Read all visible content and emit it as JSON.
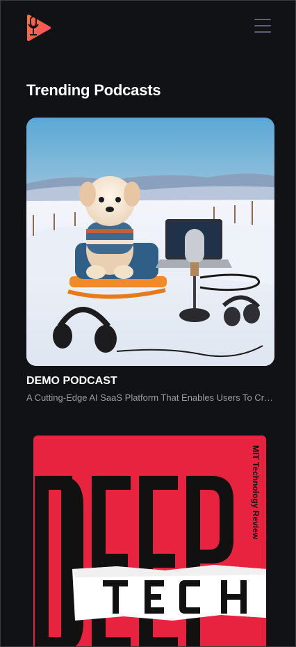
{
  "header": {
    "logo_icon": "podcast-microphone-play-logo-icon",
    "menu_icon": "hamburger-menu-icon"
  },
  "trending": {
    "title": "Trending Podcasts",
    "podcasts": [
      {
        "title": "DEMO PODCAST",
        "description": "A Cutting-Edge AI SaaS Platform That Enables Users To Create",
        "cover_icon": "puppy-snow-podcast-cover-image"
      },
      {
        "title": "",
        "description": "",
        "cover_icon": "deep-tech-cover-image",
        "cover_brand": "MIT Technology Review",
        "cover_word_1": "DEEP",
        "cover_word_2": "TECH"
      }
    ]
  },
  "colors": {
    "background": "#111215",
    "accent_gradient_start": "#f97535",
    "accent_gradient_end": "#f14a6b",
    "menu_icon": "#5d6077",
    "description_text": "#9c9ea8",
    "deep_tech_red": "#e8233f"
  }
}
